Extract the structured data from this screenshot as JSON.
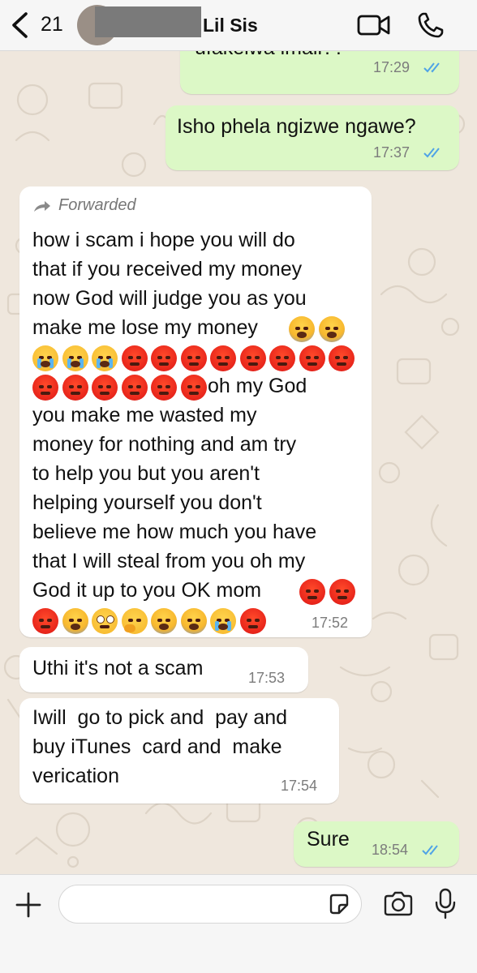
{
  "header": {
    "back_count": "21",
    "contact_name": "Lil Sis",
    "icons": [
      "chevron-left-icon",
      "video-camera-icon",
      "phone-icon"
    ]
  },
  "messages": [
    {
      "direction": "outgoing",
      "text": "ufakelwa imali??",
      "time": "17:29",
      "status": "read"
    },
    {
      "direction": "outgoing",
      "text": "Isho phela ngizwe ngawe?",
      "time": "17:37",
      "status": "read"
    },
    {
      "direction": "incoming",
      "forwarded": true,
      "forwarded_label": "Forwarded",
      "text_lines": [
        "how i scam i hope you will do",
        "that if you received my money",
        "now God will judge you as you",
        "make me lose my money"
      ],
      "emoji_after_line4": [
        "😱",
        "😱"
      ],
      "emoji_line5": [
        "😭",
        "😭",
        "😭",
        "😡",
        "😡",
        "😡",
        "😡",
        "😡",
        "😡",
        "😡",
        "😡"
      ],
      "emoji_line6": [
        "😡",
        "😡",
        "😡",
        "😡",
        "😡",
        "😡"
      ],
      "line6_text": "oh my God",
      "text_lines_2": [
        "you make me wasted my",
        "money for nothing and am try",
        "to help you but you aren't",
        "helping yourself you don't",
        "believe me how much you have",
        "that I will steal from you oh my",
        "God it up to you OK mom"
      ],
      "emoji_after_mom": [
        "😡",
        "😡"
      ],
      "emoji_last_line": [
        "😡",
        "😱",
        "🙄",
        "🤔",
        "😱",
        "😱",
        "😭",
        "😡"
      ],
      "time": "17:52"
    },
    {
      "direction": "incoming",
      "text": "Uthi it's not a scam",
      "time": "17:53"
    },
    {
      "direction": "incoming",
      "text_lines": [
        "Iwill  go to pick and  pay and",
        "buy iTunes  card and  make",
        "verication"
      ],
      "time": "17:54"
    },
    {
      "direction": "outgoing",
      "text": "Sure",
      "time": "18:54",
      "status": "read"
    }
  ],
  "input": {
    "placeholder": "",
    "icons": [
      "plus-icon",
      "sticker-icon",
      "camera-icon",
      "microphone-icon"
    ]
  },
  "colors": {
    "outgoing_bubble": "#dcf8c6",
    "incoming_bubble": "#ffffff",
    "chat_background": "#efe7dd",
    "read_ticks": "#4fa3e6"
  }
}
